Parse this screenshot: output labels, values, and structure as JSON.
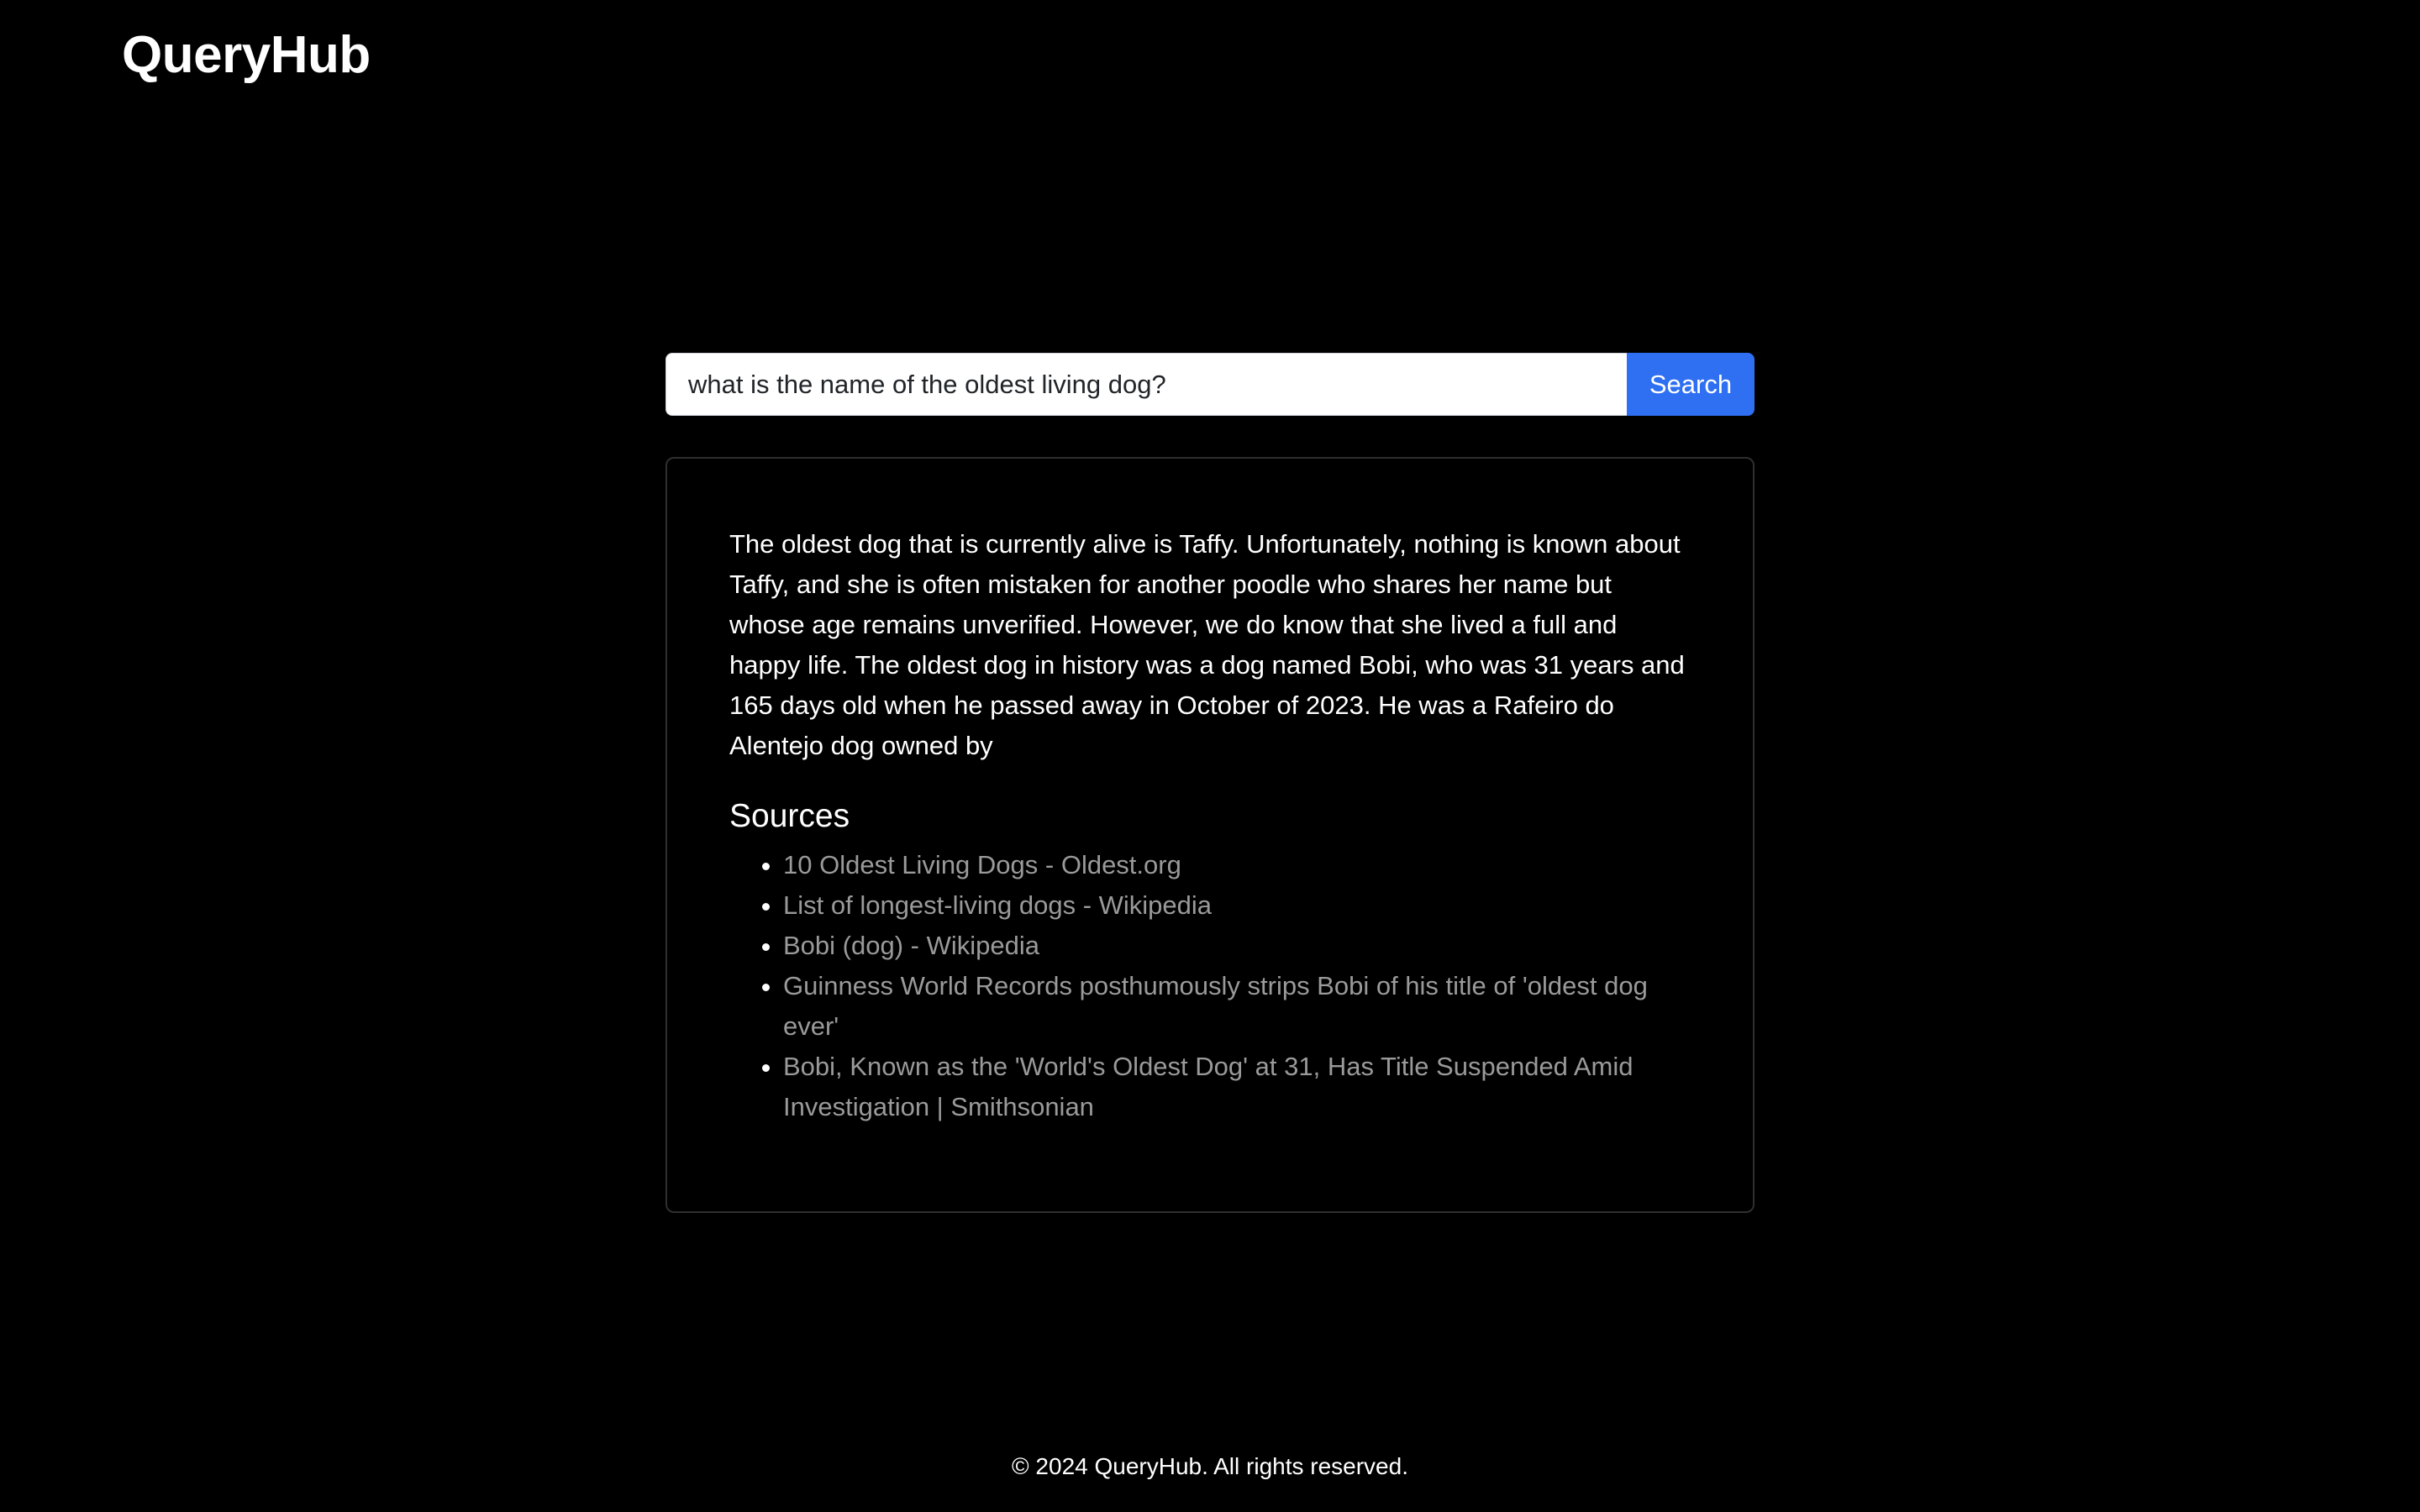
{
  "header": {
    "brand": "QueryHub"
  },
  "search": {
    "value": "what is the name of the oldest living dog?",
    "placeholder": "",
    "button_label": "Search"
  },
  "result": {
    "answer": "The oldest dog that is currently alive is Taffy. Unfortunately, nothing is known about Taffy, and she is often mistaken for another poodle who shares her name but whose age remains unverified. However, we do know that she lived a full and happy life. The oldest dog in history was a dog named Bobi, who was 31 years and 165 days old when he passed away in October of 2023. He was a Rafeiro do Alentejo dog owned by",
    "sources_heading": "Sources",
    "sources": [
      "10 Oldest Living Dogs - Oldest.org",
      "List of longest-living dogs - Wikipedia",
      "Bobi (dog) - Wikipedia",
      "Guinness World Records posthumously strips Bobi of his title of 'oldest dog ever'",
      "Bobi, Known as the 'World's Oldest Dog' at 31, Has Title Suspended Amid Investigation | Smithsonian"
    ]
  },
  "footer": {
    "text": "© 2024 QueryHub. All rights reserved."
  },
  "colors": {
    "background": "#000000",
    "accent": "#2f6ff2",
    "link": "#9a9a9a",
    "card_border": "#2f2f2f"
  }
}
